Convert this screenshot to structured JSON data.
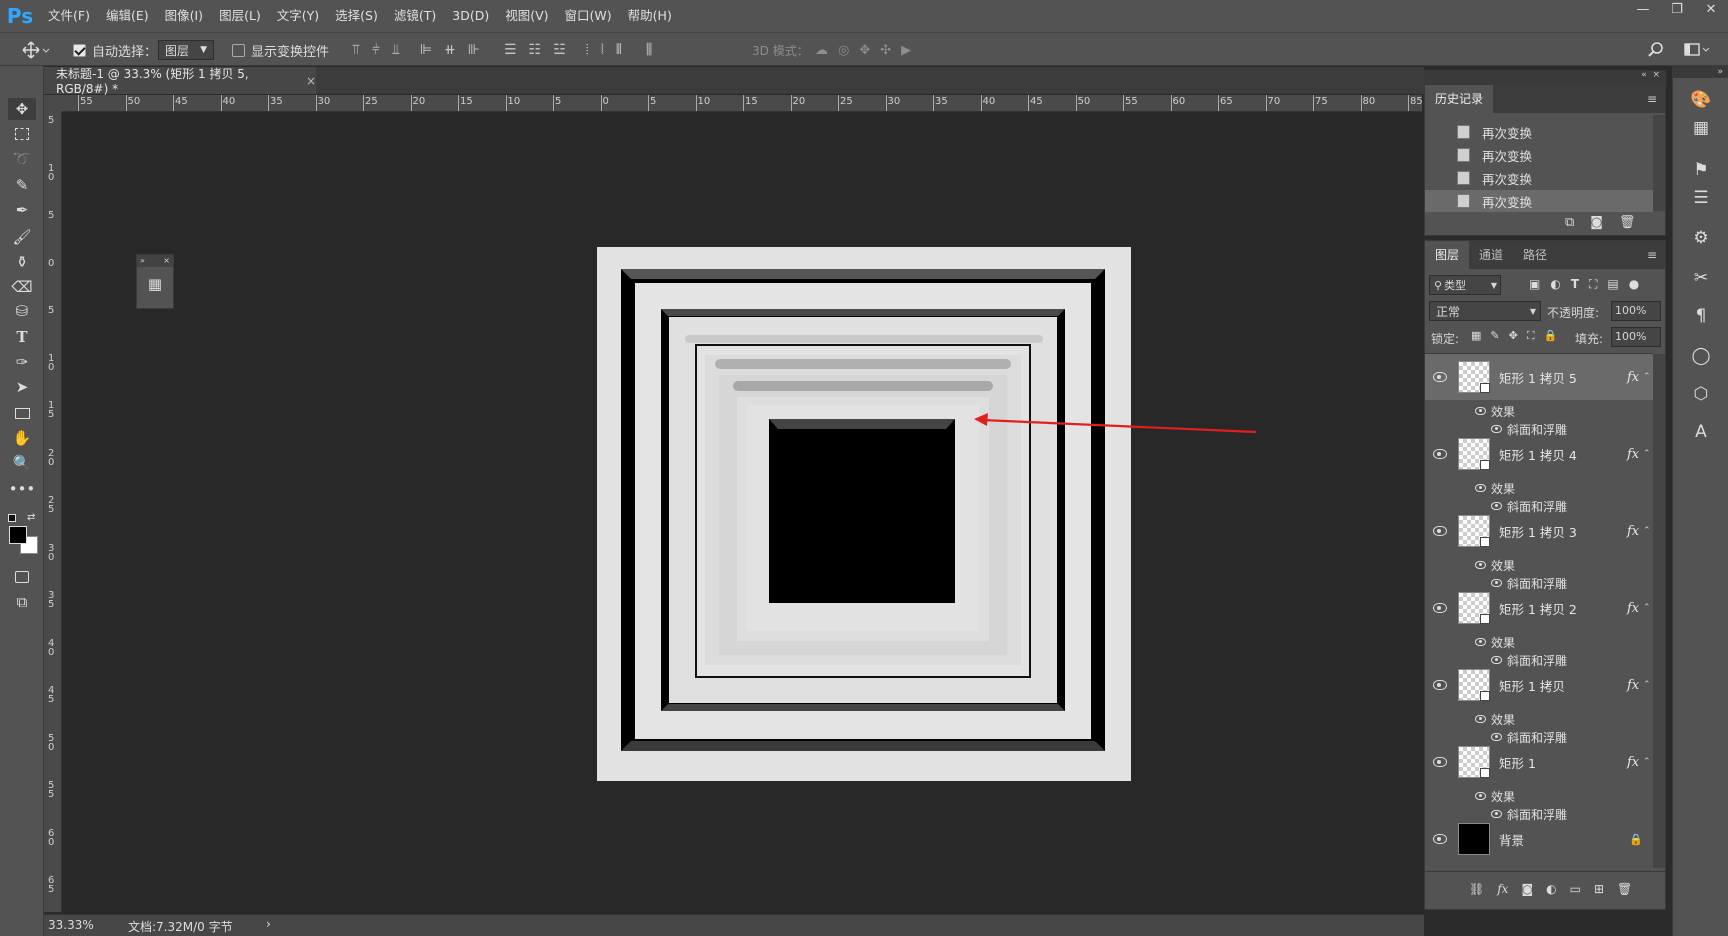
{
  "app": {
    "logo": "Ps"
  },
  "menu": [
    "文件(F)",
    "编辑(E)",
    "图像(I)",
    "图层(L)",
    "文字(Y)",
    "选择(S)",
    "滤镜(T)",
    "3D(D)",
    "视图(V)",
    "窗口(W)",
    "帮助(H)"
  ],
  "window_controls": {
    "minimize": "—",
    "maximize": "❐",
    "close": "✕"
  },
  "options": {
    "auto_select_label": "自动选择：",
    "auto_select_value": "图层",
    "show_transform_label": "显示变换控件",
    "mode_3d_label": "3D 模式："
  },
  "document_tab": {
    "title": "未标题-1 @ 33.3% (矩形 1 拷贝 5, RGB/8#) *",
    "close": "×"
  },
  "ruler_h": [
    "55",
    "50",
    "45",
    "40",
    "35",
    "30",
    "25",
    "20",
    "15",
    "10",
    "5",
    "0",
    "5",
    "10",
    "15",
    "20",
    "25",
    "30",
    "35",
    "40",
    "45",
    "50",
    "55",
    "60",
    "65",
    "70",
    "75",
    "80",
    "85"
  ],
  "ruler_v": [
    "5",
    "1\n0",
    "5",
    "0",
    "5",
    "1\n0",
    "1\n5",
    "2\n0",
    "2\n5",
    "3\n0",
    "3\n5",
    "4\n0",
    "4\n5",
    "5\n0",
    "5\n5",
    "6\n0",
    "6\n5"
  ],
  "status": {
    "zoom": "33.33%",
    "doc_info": "文档:7.32M/0 字节",
    "arrow": "›"
  },
  "history": {
    "tab": "历史记录",
    "items": [
      "再次变换",
      "再次变换",
      "再次变换",
      "再次变换"
    ]
  },
  "layers": {
    "tabs": [
      "图层",
      "通道",
      "路径"
    ],
    "filter_kind": "类型",
    "blend_mode": "正常",
    "opacity_label": "不透明度:",
    "opacity_value": "100%",
    "lock_label": "锁定:",
    "fill_label": "填充:",
    "fill_value": "100%",
    "items": [
      {
        "name": "矩形 1 拷贝 5",
        "effects_label": "效果",
        "effect": "斜面和浮雕",
        "fx": "fx"
      },
      {
        "name": "矩形 1 拷贝 4",
        "effects_label": "效果",
        "effect": "斜面和浮雕",
        "fx": "fx"
      },
      {
        "name": "矩形 1 拷贝 3",
        "effects_label": "效果",
        "effect": "斜面和浮雕",
        "fx": "fx"
      },
      {
        "name": "矩形 1 拷贝 2",
        "effects_label": "效果",
        "effect": "斜面和浮雕",
        "fx": "fx"
      },
      {
        "name": "矩形 1 拷贝",
        "effects_label": "效果",
        "effect": "斜面和浮雕",
        "fx": "fx"
      },
      {
        "name": "矩形 1",
        "effects_label": "效果",
        "effect": "斜面和浮雕",
        "fx": "fx"
      }
    ],
    "background": {
      "name": "背景"
    },
    "bottom_fx": "fx"
  },
  "colors": {
    "accent": "#31a8ff",
    "annotation_arrow": "#e02020",
    "selected_layer": "#6a6a6a"
  }
}
